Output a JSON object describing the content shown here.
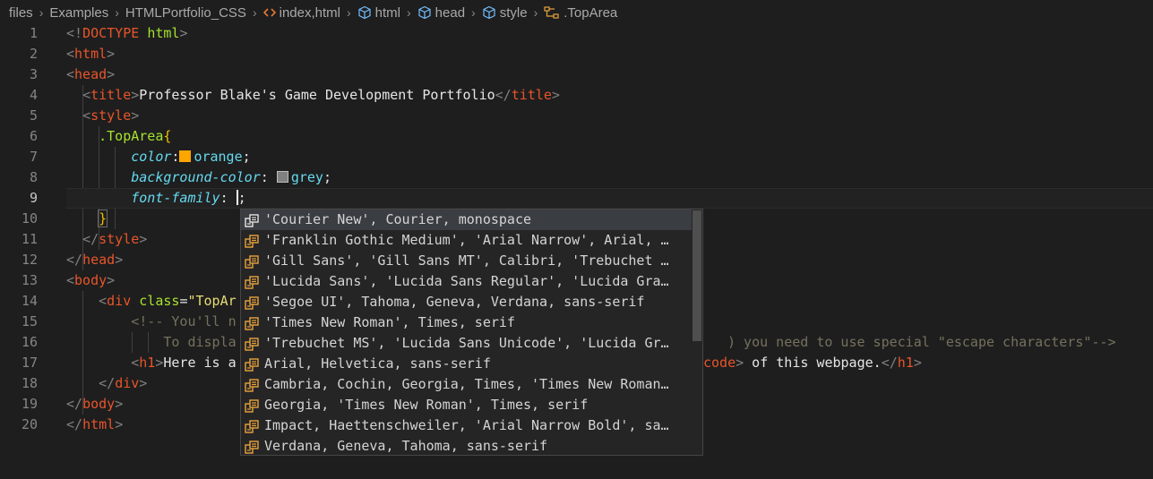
{
  "breadcrumb": {
    "items": [
      {
        "label": "files",
        "icon": "none"
      },
      {
        "label": "Examples",
        "icon": "none"
      },
      {
        "label": "HTMLPortfolio_CSS",
        "icon": "none"
      },
      {
        "label": "index,html",
        "icon": "html-file-icon"
      },
      {
        "label": "html",
        "icon": "cube-icon"
      },
      {
        "label": "head",
        "icon": "cube-icon"
      },
      {
        "label": "style",
        "icon": "cube-icon"
      },
      {
        "label": ".TopArea",
        "icon": "css-selector-icon"
      }
    ]
  },
  "editor": {
    "current_line": 9,
    "lines": [
      {
        "n": "1"
      },
      {
        "n": "2"
      },
      {
        "n": "3"
      },
      {
        "n": "4"
      },
      {
        "n": "5"
      },
      {
        "n": "6"
      },
      {
        "n": "7"
      },
      {
        "n": "8"
      },
      {
        "n": "9"
      },
      {
        "n": "10"
      },
      {
        "n": "11"
      },
      {
        "n": "12"
      },
      {
        "n": "13"
      },
      {
        "n": "14"
      },
      {
        "n": "15"
      },
      {
        "n": "16"
      },
      {
        "n": "17"
      },
      {
        "n": "18"
      },
      {
        "n": "19"
      },
      {
        "n": "20"
      }
    ],
    "code": {
      "l1_doctype": "DOCTYPE",
      "l1_html": "html",
      "l2_tag": "html",
      "l3_tag": "head",
      "l4_tag": "title",
      "l4_text": "Professor Blake's Game Development Portfolio",
      "l5_tag": "style",
      "l6_selector": ".TopArea",
      "l7_prop": "color",
      "l7_value": "orange",
      "l7_swatch": "#ffa500",
      "l8_prop": "background-color",
      "l8_value": "grey",
      "l8_swatch": "#808080",
      "l9_prop": "font-family",
      "l11_tag": "style",
      "l12_tag": "head",
      "l13_tag": "body",
      "l14_tag": "div",
      "l14_attr": "class",
      "l14_str": "\"TopAr",
      "l15_comment": "<!-- You'll n",
      "l16_comment_a": "To displa",
      "l16_comment_b": ") you need to use special \"escape characters\"-->",
      "l17_tag": "h1",
      "l17_text": "Here is a",
      "l17_tag2": "code",
      "l17_text2": " of this webpage.",
      "l17_tag3": "h1",
      "l18_tag": "div",
      "l19_tag": "body",
      "l20_tag": "html"
    }
  },
  "suggestions": {
    "selected_index": 0,
    "items": [
      "'Courier New', Courier, monospace",
      "'Franklin Gothic Medium', 'Arial Narrow', Arial, …",
      "'Gill Sans', 'Gill Sans MT', Calibri, 'Trebuchet …",
      "'Lucida Sans', 'Lucida Sans Regular', 'Lucida Gra…",
      "'Segoe UI', Tahoma, Geneva, Verdana, sans-serif",
      "'Times New Roman', Times, serif",
      "'Trebuchet MS', 'Lucida Sans Unicode', 'Lucida Gr…",
      "Arial, Helvetica, sans-serif",
      "Cambria, Cochin, Georgia, Times, 'Times New Roman…",
      "Georgia, 'Times New Roman', Times, serif",
      "Impact, Haettenschweiler, 'Arial Narrow Bold', sa…",
      "Verdana, Geneva, Tahoma, sans-serif"
    ]
  },
  "colors": {
    "background": "#1e1e1e",
    "tag": "#e8552a",
    "property": "#66d9ef",
    "selector": "#a6e22e",
    "string": "#e6db74",
    "comment": "#75715e",
    "suggest_icon": "#e8a33d"
  }
}
